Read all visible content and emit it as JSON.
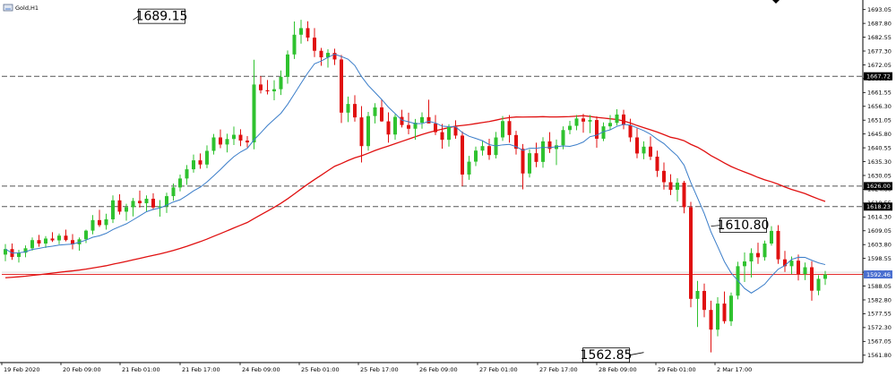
{
  "window": {
    "title": "Gold,H1",
    "icon": "chart-window-icon"
  },
  "colors": {
    "bull": "#2fc22f",
    "bear": "#e01010",
    "ma_fast": "#3a7dc9",
    "ma_slow": "#e01010",
    "grid_dash": "#555555",
    "axis": "#000000",
    "price_line": "#e01010",
    "tag_bg_level": "#000000",
    "tag_bg_price": "#4a6fd0"
  },
  "chart_data": {
    "type": "candlestick",
    "symbol": "Gold",
    "timeframe": "H1",
    "ylim": [
      1559.0,
      1696.0
    ],
    "y_ticks": [
      1693.05,
      1687.8,
      1682.55,
      1677.3,
      1672.05,
      1666.8,
      1661.55,
      1656.3,
      1651.05,
      1645.8,
      1640.55,
      1635.3,
      1630.05,
      1624.8,
      1619.55,
      1614.3,
      1609.05,
      1603.8,
      1598.55,
      1593.3,
      1588.05,
      1582.8,
      1577.55,
      1572.3,
      1567.05,
      1561.8
    ],
    "x_ticks": [
      "19 Feb 2020",
      "20 Feb 09:00",
      "21 Feb 01:00",
      "21 Feb 17:00",
      "24 Feb 09:00",
      "25 Feb 01:00",
      "25 Feb 17:00",
      "26 Feb 09:00",
      "27 Feb 01:00",
      "27 Feb 17:00",
      "28 Feb 09:00",
      "29 Feb 01:00",
      "2 Mar 17:00"
    ],
    "horizontal_levels": [
      {
        "price": 1667.72,
        "label": "1667.72"
      },
      {
        "price": 1626.0,
        "label": "1626.00"
      },
      {
        "price": 1618.23,
        "label": "1618.23"
      }
    ],
    "current_price": {
      "price": 1592.46,
      "label": "1592.46"
    },
    "annotations": [
      {
        "label": "1689.15",
        "price": 1689.15,
        "bar": 19
      },
      {
        "label": "1610.80",
        "price": 1610.8,
        "bar": 105
      },
      {
        "label": "1562.85",
        "price": 1562.85,
        "bar": 95
      }
    ],
    "ma_fast": {
      "period": 10
    },
    "ma_slow": {
      "period": 50
    },
    "ma_slow_start": 1591.0,
    "candles": [
      [
        1600.0,
        1604.0,
        1597.5,
        1602.1
      ],
      [
        1602.1,
        1604.2,
        1598.0,
        1599.1
      ],
      [
        1599.1,
        1601.8,
        1597.0,
        1600.7
      ],
      [
        1600.7,
        1603.5,
        1599.0,
        1602.4
      ],
      [
        1602.4,
        1606.5,
        1601.5,
        1605.5
      ],
      [
        1605.5,
        1607.5,
        1603.0,
        1604.2
      ],
      [
        1604.2,
        1607.0,
        1602.5,
        1606.1
      ],
      [
        1606.1,
        1608.5,
        1604.8,
        1605.4
      ],
      [
        1605.4,
        1608.0,
        1603.9,
        1607.2
      ],
      [
        1607.2,
        1609.5,
        1605.0,
        1605.5
      ],
      [
        1605.5,
        1607.8,
        1602.0,
        1603.9
      ],
      [
        1603.9,
        1606.5,
        1601.5,
        1605.8
      ],
      [
        1605.8,
        1609.5,
        1604.4,
        1609.1
      ],
      [
        1609.1,
        1615.0,
        1607.7,
        1613.1
      ],
      [
        1613.1,
        1617.0,
        1610.5,
        1611.2
      ],
      [
        1611.2,
        1615.5,
        1609.5,
        1613.4
      ],
      [
        1613.4,
        1622.5,
        1612.0,
        1620.6
      ],
      [
        1620.6,
        1622.9,
        1615.2,
        1616.3
      ],
      [
        1616.3,
        1619.3,
        1612.9,
        1618.0
      ],
      [
        1618.0,
        1621.5,
        1614.5,
        1620.4
      ],
      [
        1620.4,
        1624.3,
        1617.9,
        1619.5
      ],
      [
        1619.5,
        1622.5,
        1616.5,
        1621.2
      ],
      [
        1621.2,
        1623.3,
        1616.9,
        1617.9
      ],
      [
        1617.9,
        1620.7,
        1614.4,
        1618.3
      ],
      [
        1618.3,
        1623.5,
        1615.8,
        1622.2
      ],
      [
        1622.2,
        1627.0,
        1620.5,
        1625.5
      ],
      [
        1625.5,
        1630.4,
        1624.0,
        1628.9
      ],
      [
        1628.9,
        1634.0,
        1626.5,
        1632.4
      ],
      [
        1632.4,
        1638.0,
        1631.1,
        1635.8
      ],
      [
        1635.8,
        1638.4,
        1632.6,
        1634.2
      ],
      [
        1634.2,
        1641.5,
        1632.8,
        1639.4
      ],
      [
        1639.4,
        1645.8,
        1638.0,
        1644.5
      ],
      [
        1644.5,
        1647.5,
        1640.4,
        1641.8
      ],
      [
        1641.8,
        1645.9,
        1638.8,
        1643.9
      ],
      [
        1643.9,
        1648.6,
        1641.6,
        1645.5
      ],
      [
        1645.5,
        1647.6,
        1641.2,
        1643.3
      ],
      [
        1643.3,
        1645.0,
        1640.7,
        1642.6
      ],
      [
        1642.6,
        1674.0,
        1640.0,
        1664.6
      ],
      [
        1664.6,
        1667.8,
        1661.2,
        1662.4
      ],
      [
        1662.4,
        1666.3,
        1660.8,
        1662.0
      ],
      [
        1662.0,
        1666.2,
        1658.6,
        1662.8
      ],
      [
        1662.8,
        1669.9,
        1660.6,
        1667.5
      ],
      [
        1667.5,
        1677.5,
        1664.9,
        1676.0
      ],
      [
        1676.0,
        1688.5,
        1674.3,
        1683.5
      ],
      [
        1683.5,
        1689.15,
        1680.1,
        1686.0
      ],
      [
        1686.0,
        1688.6,
        1681.0,
        1682.4
      ],
      [
        1682.4,
        1686.0,
        1675.0,
        1677.4
      ],
      [
        1677.4,
        1678.5,
        1671.7,
        1674.9
      ],
      [
        1674.9,
        1678.0,
        1671.0,
        1676.6
      ],
      [
        1676.6,
        1678.2,
        1672.0,
        1674.1
      ],
      [
        1674.1,
        1675.8,
        1650.0,
        1653.9
      ],
      [
        1653.9,
        1660.0,
        1650.3,
        1657.2
      ],
      [
        1657.2,
        1660.5,
        1650.5,
        1652.1
      ],
      [
        1652.1,
        1656.4,
        1635.0,
        1641.2
      ],
      [
        1641.2,
        1654.2,
        1639.5,
        1652.6
      ],
      [
        1652.6,
        1657.5,
        1649.8,
        1655.9
      ],
      [
        1655.9,
        1659.0,
        1650.4,
        1650.6
      ],
      [
        1650.6,
        1654.0,
        1642.5,
        1645.6
      ],
      [
        1645.6,
        1653.3,
        1643.6,
        1652.3
      ],
      [
        1652.3,
        1655.0,
        1648.3,
        1649.2
      ],
      [
        1649.2,
        1653.9,
        1645.7,
        1647.8
      ],
      [
        1647.8,
        1651.5,
        1643.6,
        1650.1
      ],
      [
        1650.1,
        1654.0,
        1647.8,
        1652.2
      ],
      [
        1652.2,
        1658.8,
        1650.2,
        1649.8
      ],
      [
        1649.8,
        1653.0,
        1645.4,
        1646.5
      ],
      [
        1646.5,
        1649.6,
        1640.2,
        1643.6
      ],
      [
        1643.6,
        1649.5,
        1641.0,
        1648.5
      ],
      [
        1648.5,
        1651.0,
        1644.0,
        1645.2
      ],
      [
        1645.2,
        1646.8,
        1626.0,
        1630.4
      ],
      [
        1630.4,
        1637.5,
        1628.4,
        1635.3
      ],
      [
        1635.3,
        1641.0,
        1633.6,
        1639.5
      ],
      [
        1639.5,
        1643.4,
        1637.6,
        1641.2
      ],
      [
        1641.2,
        1644.0,
        1636.0,
        1637.8
      ],
      [
        1637.8,
        1646.6,
        1636.5,
        1644.5
      ],
      [
        1644.5,
        1652.6,
        1643.2,
        1650.7
      ],
      [
        1650.7,
        1653.0,
        1642.5,
        1645.4
      ],
      [
        1645.4,
        1647.0,
        1638.0,
        1640.2
      ],
      [
        1640.2,
        1642.0,
        1624.8,
        1630.8
      ],
      [
        1630.8,
        1640.0,
        1629.3,
        1638.5
      ],
      [
        1638.5,
        1642.5,
        1633.2,
        1635.2
      ],
      [
        1635.2,
        1644.6,
        1633.0,
        1643.0
      ],
      [
        1643.0,
        1646.5,
        1638.6,
        1640.1
      ],
      [
        1640.1,
        1643.7,
        1634.0,
        1641.5
      ],
      [
        1641.5,
        1648.7,
        1640.0,
        1647.3
      ],
      [
        1647.3,
        1650.8,
        1645.7,
        1648.9
      ],
      [
        1648.9,
        1653.0,
        1647.2,
        1651.7
      ],
      [
        1651.7,
        1653.4,
        1646.3,
        1650.5
      ],
      [
        1650.5,
        1653.0,
        1646.1,
        1651.1
      ],
      [
        1651.1,
        1652.5,
        1640.6,
        1644.0
      ],
      [
        1644.0,
        1650.2,
        1643.1,
        1648.7
      ],
      [
        1648.7,
        1653.0,
        1647.3,
        1650.0
      ],
      [
        1650.0,
        1655.2,
        1649.0,
        1653.2
      ],
      [
        1653.2,
        1655.0,
        1647.6,
        1649.2
      ],
      [
        1649.2,
        1651.6,
        1642.8,
        1644.5
      ],
      [
        1644.5,
        1648.0,
        1636.6,
        1638.4
      ],
      [
        1638.4,
        1643.0,
        1636.2,
        1641.0
      ],
      [
        1641.0,
        1644.9,
        1635.9,
        1637.2
      ],
      [
        1637.2,
        1639.5,
        1629.5,
        1631.8
      ],
      [
        1631.8,
        1635.0,
        1624.7,
        1627.5
      ],
      [
        1627.5,
        1630.5,
        1622.6,
        1624.6
      ],
      [
        1624.6,
        1629.0,
        1620.2,
        1627.3
      ],
      [
        1627.3,
        1628.0,
        1615.7,
        1618.0
      ],
      [
        1618.0,
        1620.0,
        1580.0,
        1583.2
      ],
      [
        1583.2,
        1590.0,
        1572.5,
        1586.2
      ],
      [
        1586.2,
        1589.0,
        1576.2,
        1579.0
      ],
      [
        1579.0,
        1582.5,
        1562.85,
        1571.5
      ],
      [
        1571.5,
        1583.8,
        1569.0,
        1581.4
      ],
      [
        1581.4,
        1586.0,
        1573.8,
        1574.7
      ],
      [
        1574.7,
        1585.6,
        1572.9,
        1584.4
      ],
      [
        1584.4,
        1597.3,
        1583.0,
        1595.6
      ],
      [
        1595.6,
        1600.8,
        1589.6,
        1597.4
      ],
      [
        1597.4,
        1602.4,
        1591.3,
        1600.6
      ],
      [
        1600.6,
        1604.5,
        1596.5,
        1599.0
      ],
      [
        1599.0,
        1605.3,
        1597.7,
        1604.2
      ],
      [
        1604.2,
        1610.8,
        1603.4,
        1609.0
      ],
      [
        1609.0,
        1611.2,
        1596.5,
        1598.2
      ],
      [
        1598.2,
        1601.4,
        1593.4,
        1595.6
      ],
      [
        1595.6,
        1599.3,
        1592.6,
        1597.7
      ],
      [
        1597.7,
        1600.0,
        1590.2,
        1592.6
      ],
      [
        1592.6,
        1597.0,
        1590.3,
        1595.2
      ],
      [
        1595.2,
        1597.5,
        1582.5,
        1586.3
      ],
      [
        1586.3,
        1592.2,
        1584.6,
        1590.8
      ],
      [
        1590.8,
        1593.8,
        1588.5,
        1592.46
      ]
    ]
  }
}
